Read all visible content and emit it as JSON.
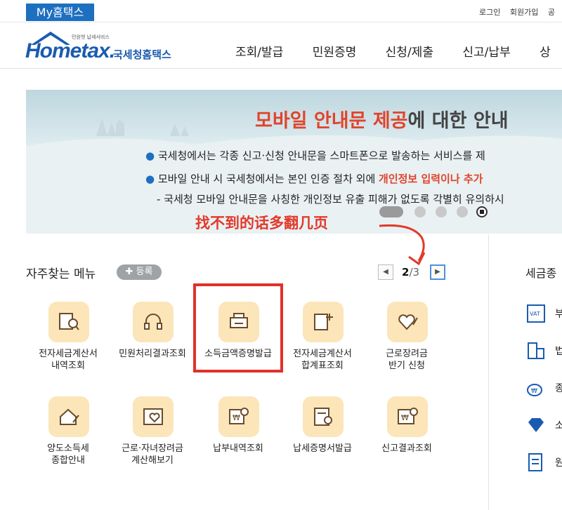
{
  "topbar": {
    "my_tab": "My홈택스",
    "links": [
      "로그인",
      "회원가입",
      "공"
    ]
  },
  "header": {
    "logo_text": "Hometax.",
    "logo_tagline": "민원엣 납세서비스",
    "logo_kr": "국세청홈택스",
    "nav": [
      "조회/발급",
      "민원증명",
      "신청/제출",
      "신고/납부",
      "상"
    ]
  },
  "banner": {
    "title_highlight": "모바일 안내문 제공",
    "title_rest": "에 대한 안내",
    "line1": "국세청에서는 각종 신고·신청 안내문을 스마트폰으로 발송하는 서비스를 제",
    "line2_prefix": "모바일 안내 시 국세청에서는 본인 인증 절차 외에 ",
    "line2_red": "개인정보 입력이나 추가",
    "line3": "- 국세청 모바일 안내문을 사칭한 개인정보 유출 피해가 없도록 각별히 유의하시"
  },
  "annotation": "找不到的话多翻几页",
  "favorites": {
    "title": "자주찾는 메뉴",
    "register_label": "등록",
    "page_current": "2",
    "page_total": "/3",
    "items": [
      {
        "label": "전자세금계산서\n내역조회"
      },
      {
        "label": "민원처리결과조회"
      },
      {
        "label": "소득금액증명발급"
      },
      {
        "label": "전자세금계산서\n합계표조회"
      },
      {
        "label": "근로장려금\n반기 신청"
      },
      {
        "label": "양도소득세\n종합안내"
      },
      {
        "label": "근로·자녀장려금\n계산해보기"
      },
      {
        "label": "납부내역조회"
      },
      {
        "label": "납세증명서발급"
      },
      {
        "label": "신고결과조회"
      }
    ]
  },
  "side": {
    "title": "세금종",
    "items": [
      "부",
      "법",
      "종",
      "소",
      "원"
    ]
  },
  "colors": {
    "brand_blue": "#1d6fc0",
    "highlight_red": "#e0442b",
    "icon_bg": "#fbe5b9"
  }
}
